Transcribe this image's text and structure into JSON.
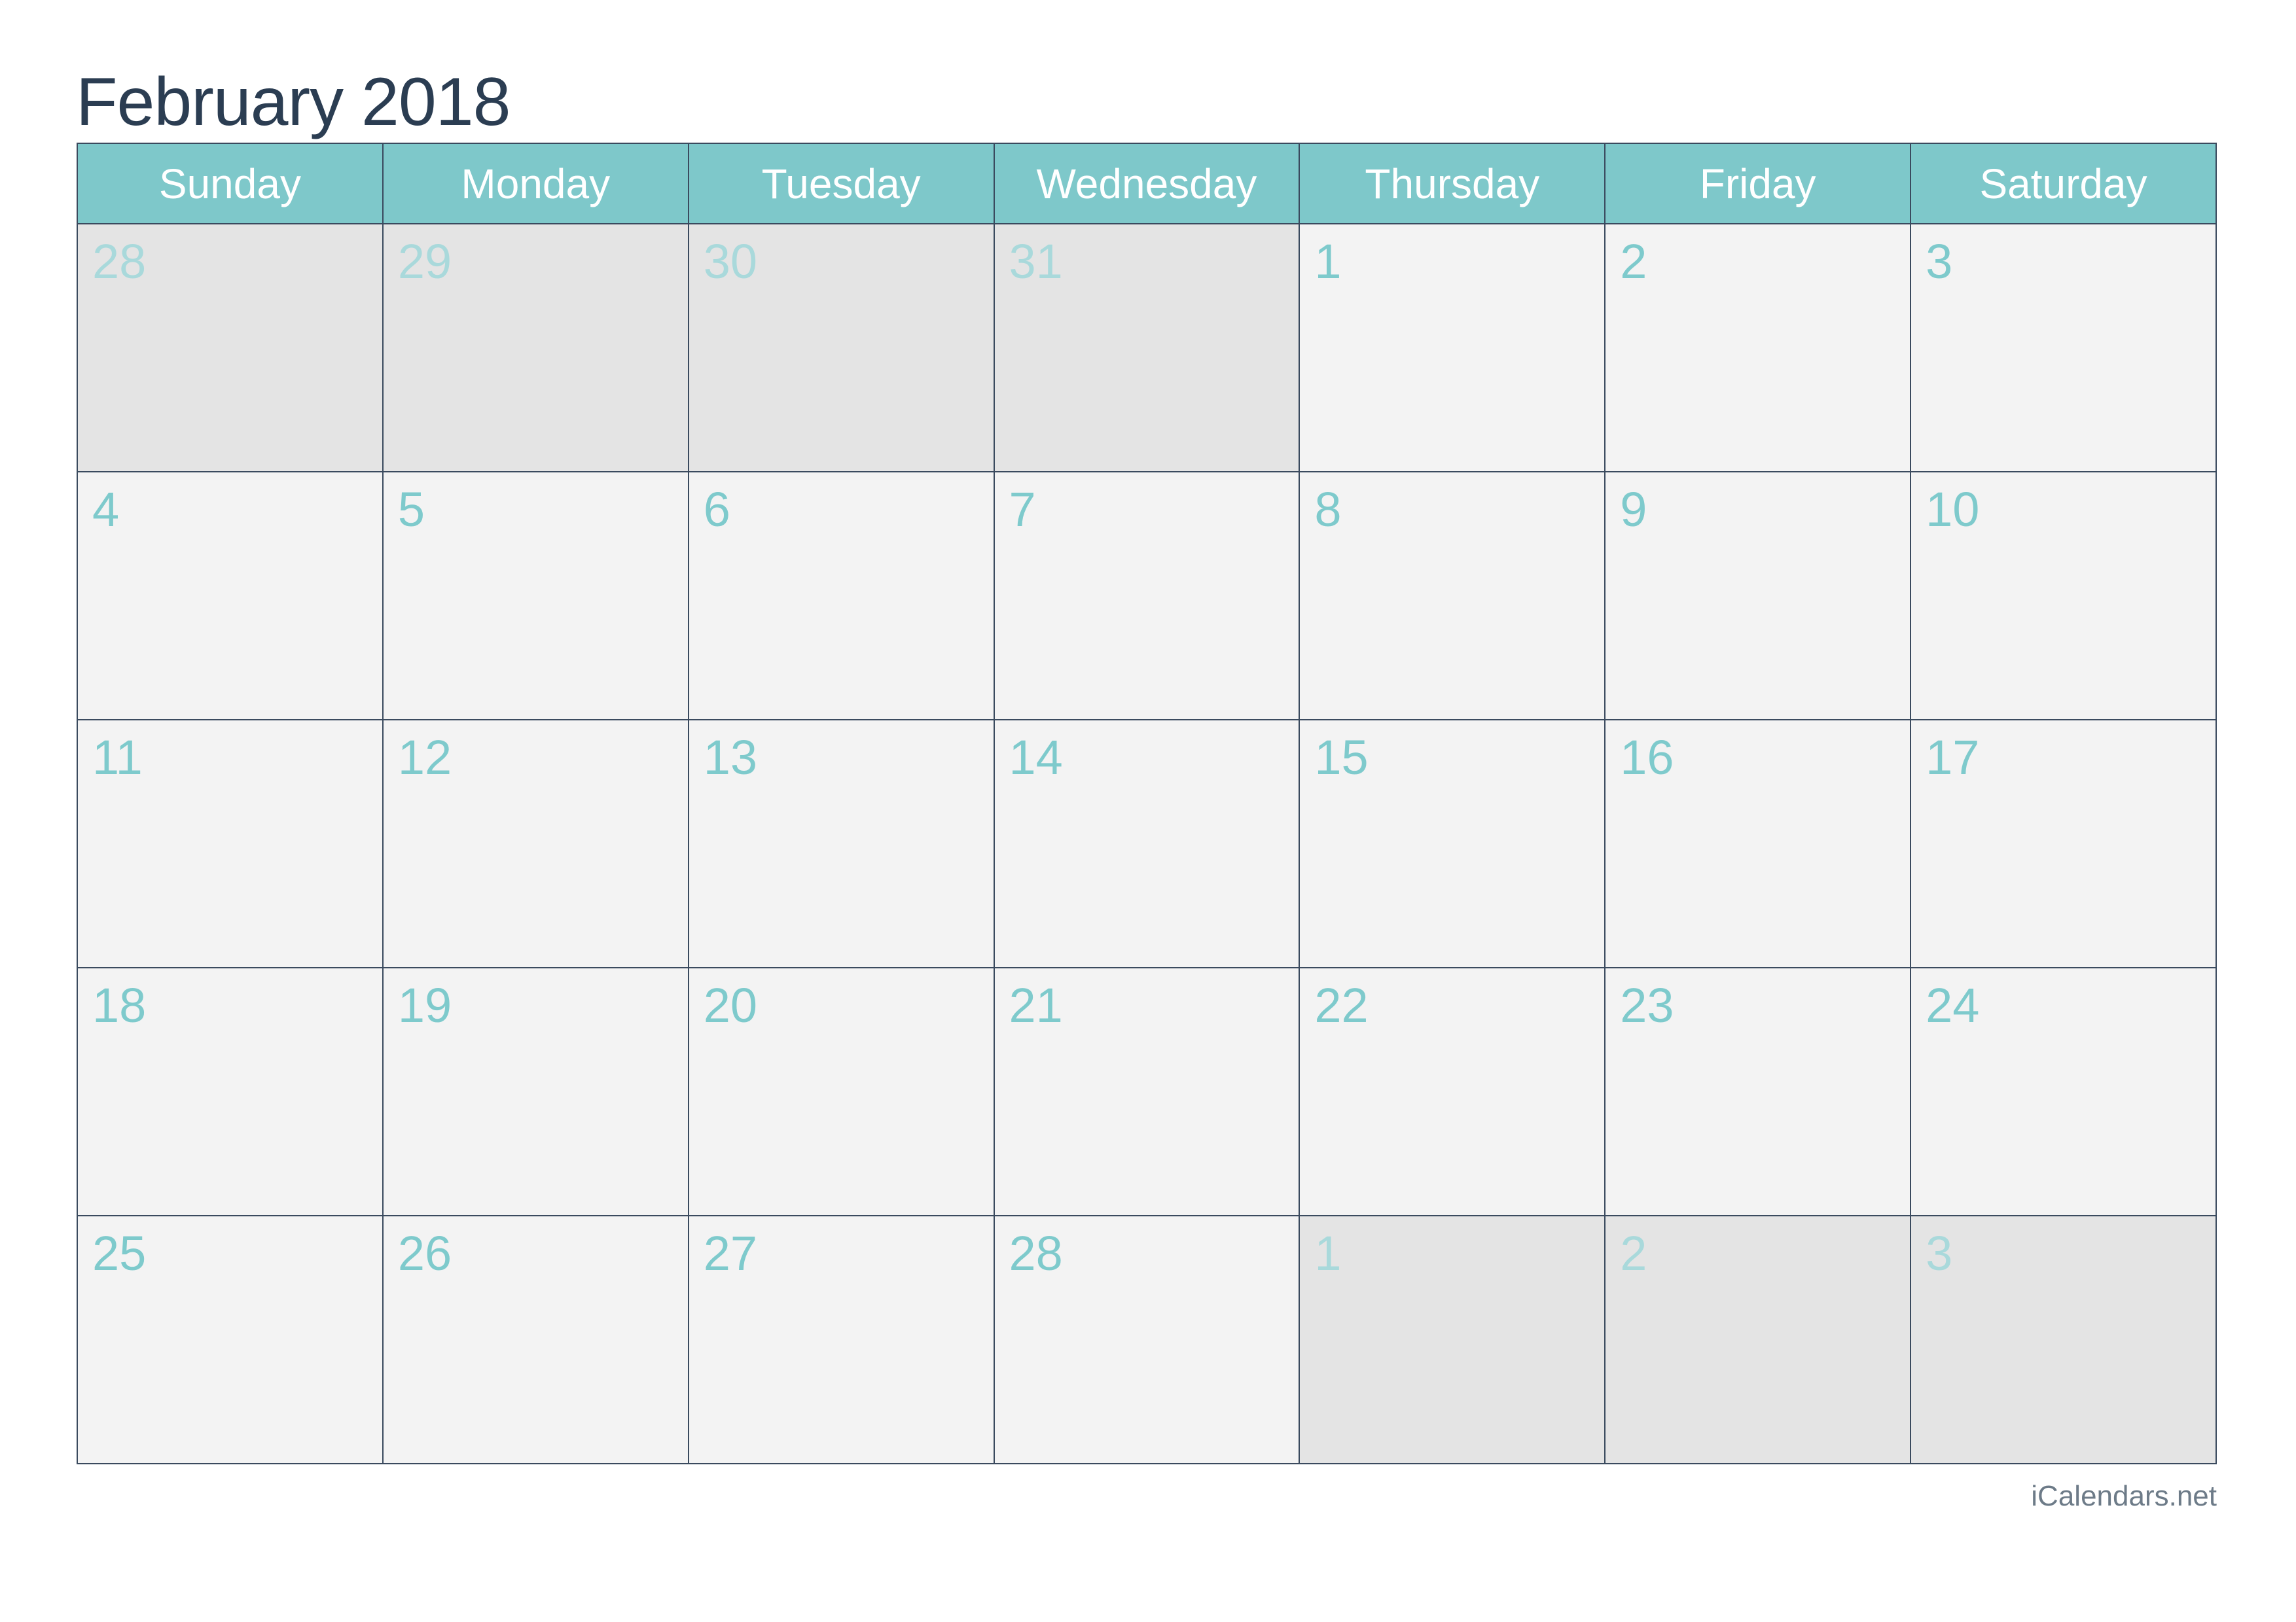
{
  "title": "February 2018",
  "weekdays": [
    "Sunday",
    "Monday",
    "Tuesday",
    "Wednesday",
    "Thursday",
    "Friday",
    "Saturday"
  ],
  "weeks": [
    [
      {
        "day": "28",
        "muted": true
      },
      {
        "day": "29",
        "muted": true
      },
      {
        "day": "30",
        "muted": true
      },
      {
        "day": "31",
        "muted": true
      },
      {
        "day": "1",
        "muted": false
      },
      {
        "day": "2",
        "muted": false
      },
      {
        "day": "3",
        "muted": false
      }
    ],
    [
      {
        "day": "4",
        "muted": false
      },
      {
        "day": "5",
        "muted": false
      },
      {
        "day": "6",
        "muted": false
      },
      {
        "day": "7",
        "muted": false
      },
      {
        "day": "8",
        "muted": false
      },
      {
        "day": "9",
        "muted": false
      },
      {
        "day": "10",
        "muted": false
      }
    ],
    [
      {
        "day": "11",
        "muted": false
      },
      {
        "day": "12",
        "muted": false
      },
      {
        "day": "13",
        "muted": false
      },
      {
        "day": "14",
        "muted": false
      },
      {
        "day": "15",
        "muted": false
      },
      {
        "day": "16",
        "muted": false
      },
      {
        "day": "17",
        "muted": false
      }
    ],
    [
      {
        "day": "18",
        "muted": false
      },
      {
        "day": "19",
        "muted": false
      },
      {
        "day": "20",
        "muted": false
      },
      {
        "day": "21",
        "muted": false
      },
      {
        "day": "22",
        "muted": false
      },
      {
        "day": "23",
        "muted": false
      },
      {
        "day": "24",
        "muted": false
      }
    ],
    [
      {
        "day": "25",
        "muted": false
      },
      {
        "day": "26",
        "muted": false
      },
      {
        "day": "27",
        "muted": false
      },
      {
        "day": "28",
        "muted": false
      },
      {
        "day": "1",
        "muted": true
      },
      {
        "day": "2",
        "muted": true
      },
      {
        "day": "3",
        "muted": true
      }
    ]
  ],
  "footer": "iCalendars.net",
  "colors": {
    "header_bg": "#7ec8ca",
    "day_number": "#7ecacc",
    "muted_day_number": "#a9d9db",
    "title": "#2b3d52",
    "cell_bg": "#f3f3f3",
    "muted_cell_bg": "#e4e4e4"
  }
}
